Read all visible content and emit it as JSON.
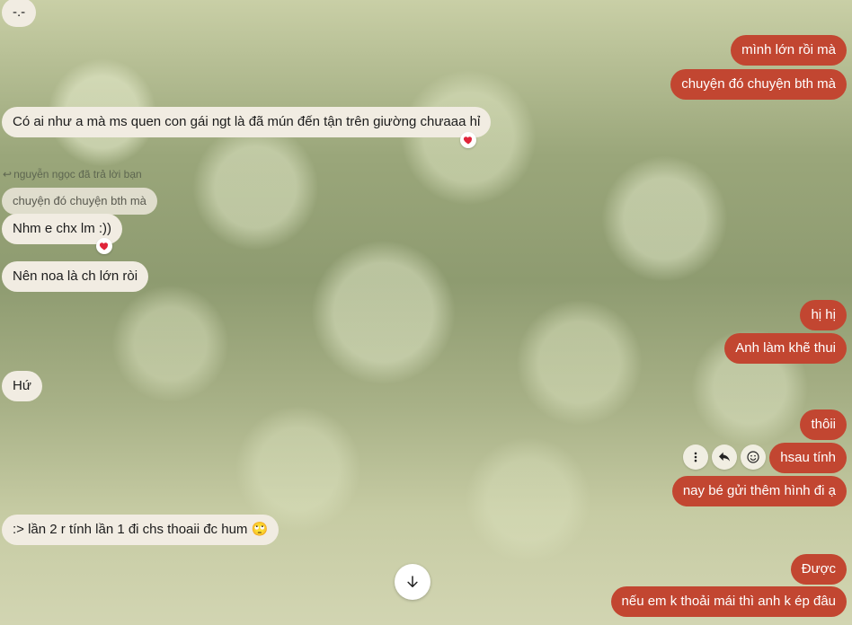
{
  "messages": {
    "m1": "-.-",
    "m2": "mình lớn rồi mà",
    "m3": "chuyện đó chuyện bth mà",
    "m4": "Có ai như a mà ms quen con gái ngt là đã mún đến tận trên giường chưaaa hỉ",
    "reply_header": "nguyễn ngọc đã trả lời bạn",
    "quoted": "chuyện đó chuyện bth mà",
    "m5": "Nhm e chx lm :))",
    "m6": "Nên noa là ch lớn ròi",
    "m7": "hị hị",
    "m8": "Anh làm khẽ  thui",
    "m9": "Hứ",
    "m10": "thôii",
    "m11": "hsau tính",
    "m12": "nay bé gửi thêm hình đi ạ",
    "m13": ":> lần 2 r tính lần 1 đi chs thoaii đc hum 🙄",
    "m14": "Được",
    "m15": "nếu em k thoải mái thì anh k ép đâu"
  },
  "reactions": {
    "heart": "❤️"
  },
  "icons": {
    "reply_indicator": "reply-arrow-icon",
    "more": "more-vertical-icon",
    "reply": "reply-icon",
    "emoji": "emoji-icon",
    "scroll_down": "arrow-down-icon",
    "heart": "heart-icon"
  },
  "colors": {
    "outgoing_bubble": "#c24631",
    "incoming_bubble": "#f1ece2",
    "reaction_heart": "#e0243a"
  }
}
